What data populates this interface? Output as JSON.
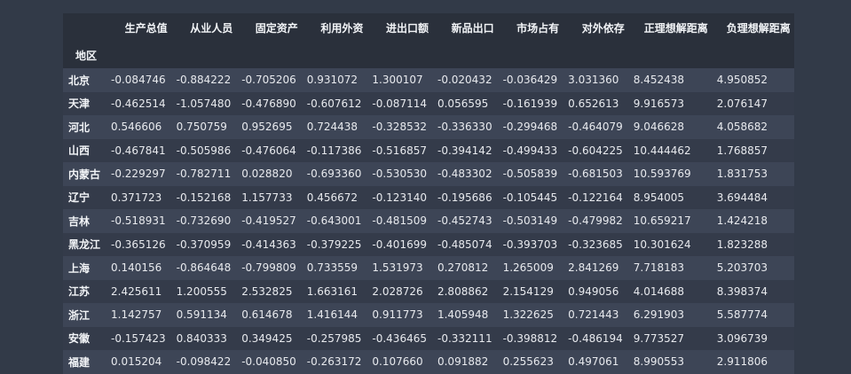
{
  "table": {
    "index_name": "地区",
    "columns": [
      "生产总值",
      "从业人员",
      "固定资产",
      "利用外资",
      "进出口额",
      "新品出口",
      "市场占有",
      "对外依存",
      "正理想解距离",
      "负理想解距离"
    ],
    "rows": [
      {
        "label": "北京",
        "values": [
          "-0.084746",
          "-0.884222",
          "-0.705206",
          "0.931072",
          "1.300107",
          "-0.020432",
          "-0.036429",
          "3.031360",
          "8.452438",
          "4.950852"
        ]
      },
      {
        "label": "天津",
        "values": [
          "-0.462514",
          "-1.057480",
          "-0.476890",
          "-0.607612",
          "-0.087114",
          "0.056595",
          "-0.161939",
          "0.652613",
          "9.916573",
          "2.076147"
        ]
      },
      {
        "label": "河北",
        "values": [
          "0.546606",
          "0.750759",
          "0.952695",
          "0.724438",
          "-0.328532",
          "-0.336330",
          "-0.299468",
          "-0.464079",
          "9.046628",
          "4.058682"
        ]
      },
      {
        "label": "山西",
        "values": [
          "-0.467841",
          "-0.505986",
          "-0.476064",
          "-0.117386",
          "-0.516857",
          "-0.394142",
          "-0.499433",
          "-0.604225",
          "10.444462",
          "1.768857"
        ]
      },
      {
        "label": "内蒙古",
        "values": [
          "-0.229297",
          "-0.782711",
          "0.028820",
          "-0.693360",
          "-0.530530",
          "-0.483302",
          "-0.505839",
          "-0.681503",
          "10.593769",
          "1.831753"
        ]
      },
      {
        "label": "辽宁",
        "values": [
          "0.371723",
          "-0.152168",
          "1.157733",
          "0.456672",
          "-0.123140",
          "-0.195686",
          "-0.105445",
          "-0.122164",
          "8.954005",
          "3.694484"
        ]
      },
      {
        "label": "吉林",
        "values": [
          "-0.518931",
          "-0.732690",
          "-0.419527",
          "-0.643001",
          "-0.481509",
          "-0.452743",
          "-0.503149",
          "-0.479982",
          "10.659217",
          "1.424218"
        ]
      },
      {
        "label": "黑龙江",
        "values": [
          "-0.365126",
          "-0.370959",
          "-0.414363",
          "-0.379225",
          "-0.401699",
          "-0.485074",
          "-0.393703",
          "-0.323685",
          "10.301624",
          "1.823288"
        ]
      },
      {
        "label": "上海",
        "values": [
          "0.140156",
          "-0.864648",
          "-0.799809",
          "0.733559",
          "1.531973",
          "0.270812",
          "1.265009",
          "2.841269",
          "7.718183",
          "5.203703"
        ]
      },
      {
        "label": "江苏",
        "values": [
          "2.425611",
          "1.200555",
          "2.532825",
          "1.663161",
          "2.028726",
          "2.808862",
          "2.154129",
          "0.949056",
          "4.014688",
          "8.398374"
        ]
      },
      {
        "label": "浙江",
        "values": [
          "1.142757",
          "0.591134",
          "0.614678",
          "1.416144",
          "0.911773",
          "1.405948",
          "1.322625",
          "0.721443",
          "6.291903",
          "5.587774"
        ]
      },
      {
        "label": "安徽",
        "values": [
          "-0.157423",
          "0.840333",
          "0.349425",
          "-0.257985",
          "-0.436465",
          "-0.332111",
          "-0.398812",
          "-0.486194",
          "9.773527",
          "3.096739"
        ]
      },
      {
        "label": "福建",
        "values": [
          "0.015204",
          "-0.098422",
          "-0.040850",
          "-0.263172",
          "0.107660",
          "0.091882",
          "0.255623",
          "0.497061",
          "8.990553",
          "2.911806"
        ]
      }
    ]
  }
}
